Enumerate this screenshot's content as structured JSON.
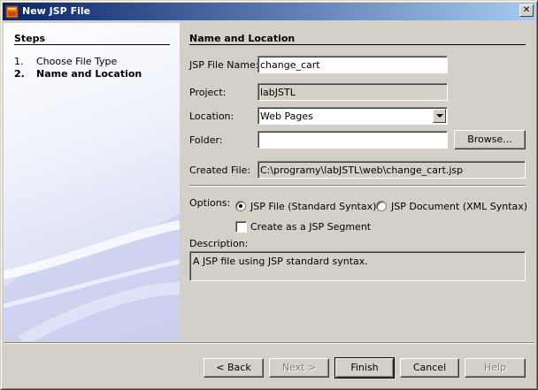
{
  "window": {
    "title": "New JSP File",
    "close_glyph": "✕"
  },
  "steps": {
    "title": "Steps",
    "items": [
      {
        "num": "1.",
        "label": "Choose File Type",
        "current": false
      },
      {
        "num": "2.",
        "label": "Name and Location",
        "current": true
      }
    ]
  },
  "main": {
    "title": "Name and Location",
    "jsp_file_name": {
      "label": "JSP File Name:",
      "value": "change_cart"
    },
    "project": {
      "label": "Project:",
      "value": "labJSTL"
    },
    "location": {
      "label": "Location:",
      "value": "Web Pages"
    },
    "folder": {
      "label": "Folder:",
      "value": "",
      "browse_label": "Browse..."
    },
    "created_file": {
      "label": "Created File:",
      "value": "C:\\programy\\labJSTL\\web\\change_cart.jsp"
    },
    "options": {
      "label": "Options:",
      "radio_standard": {
        "label": "JSP File (Standard Syntax)",
        "checked": true
      },
      "radio_xml": {
        "label": "JSP Document (XML Syntax)",
        "checked": false
      },
      "segment_checkbox": {
        "label": "Create as a JSP Segment",
        "checked": false
      }
    },
    "description": {
      "label": "Description:",
      "value": "A JSP file using JSP standard syntax."
    }
  },
  "buttons": {
    "back": "< Back",
    "next": "Next >",
    "finish": "Finish",
    "cancel": "Cancel",
    "help": "Help"
  },
  "icons": {
    "title": "jsp-file-icon",
    "close": "close-icon",
    "dropdown": "chevron-down-icon"
  }
}
